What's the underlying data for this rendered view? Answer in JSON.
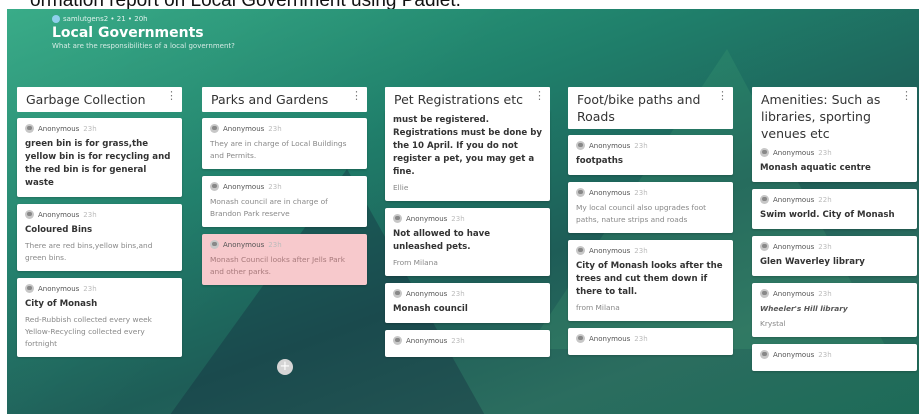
{
  "caption": "ormation report on Local Government using Padlet.",
  "header": {
    "meta": "samlutgens2 • 21 • 20h",
    "title": "Local Governments",
    "subtitle": "What are the responsibilities of a local government?"
  },
  "columns": [
    {
      "title": "Garbage Collection",
      "cards": [
        {
          "author": "Anonymous",
          "age": "23h",
          "subject": "green bin is for grass,the yellow bin is for recycling and the red bin is for general waste",
          "body": ""
        },
        {
          "author": "Anonymous",
          "age": "23h",
          "subject": "Coloured Bins",
          "body": "There are red bins,yellow bins,and green bins."
        },
        {
          "author": "Anonymous",
          "age": "23h",
          "subject": "City of Monash",
          "body": "Red-Rubbish collected every week Yellow-Recycling collected every fortnight"
        }
      ]
    },
    {
      "title": "Parks and Gardens",
      "cards": [
        {
          "author": "Anonymous",
          "age": "23h",
          "subject": "",
          "body": "They are in charge of Local Buildings and Permits."
        },
        {
          "author": "Anonymous",
          "age": "23h",
          "subject": "",
          "body": "Monash council are in charge of Brandon Park reserve"
        },
        {
          "author": "Anonymous",
          "age": "23h",
          "subject": "",
          "body": "Monash Council looks after Jells Park and other parks.",
          "highlight": true
        }
      ]
    },
    {
      "title": "Pet Registrations etc",
      "cards": [
        {
          "author": "",
          "age": "",
          "subject": "must be registered. Registrations must be done by the 10 April. If you do not register a pet, you may get a fine.",
          "body": "Ellie"
        },
        {
          "author": "Anonymous",
          "age": "23h",
          "subject": "Not allowed to have unleashed pets.",
          "body": "From Milana"
        },
        {
          "author": "Anonymous",
          "age": "23h",
          "subject": "Monash council",
          "body": ""
        },
        {
          "author": "Anonymous",
          "age": "23h",
          "subject": "",
          "body": ""
        }
      ]
    },
    {
      "title": "Foot/bike paths and Roads",
      "cards": [
        {
          "author": "Anonymous",
          "age": "23h",
          "subject": "footpaths",
          "body": ""
        },
        {
          "author": "Anonymous",
          "age": "23h",
          "subject": "",
          "body": "My local council also upgrades foot paths, nature strips and roads"
        },
        {
          "author": "Anonymous",
          "age": "23h",
          "subject": "City of Monash looks after the trees and cut them down if there to tall.",
          "body": "from Milana"
        },
        {
          "author": "Anonymous",
          "age": "23h",
          "subject": "",
          "body": ""
        }
      ]
    },
    {
      "title": "Amenities: Such as libraries, sporting venues etc",
      "cards": [
        {
          "author": "Anonymous",
          "age": "23h",
          "subject": "Monash aquatic centre",
          "body": ""
        },
        {
          "author": "Anonymous",
          "age": "22h",
          "subject": "Swim world. City of Monash",
          "body": ""
        },
        {
          "author": "Anonymous",
          "age": "23h",
          "subject": "Glen Waverley library",
          "body": ""
        },
        {
          "author": "Anonymous",
          "age": "23h",
          "subject": "",
          "body": "Wheeler's Hill library",
          "note": "Krystal"
        },
        {
          "author": "Anonymous",
          "age": "23h",
          "subject": "",
          "body": ""
        }
      ]
    }
  ],
  "add_label": "+"
}
